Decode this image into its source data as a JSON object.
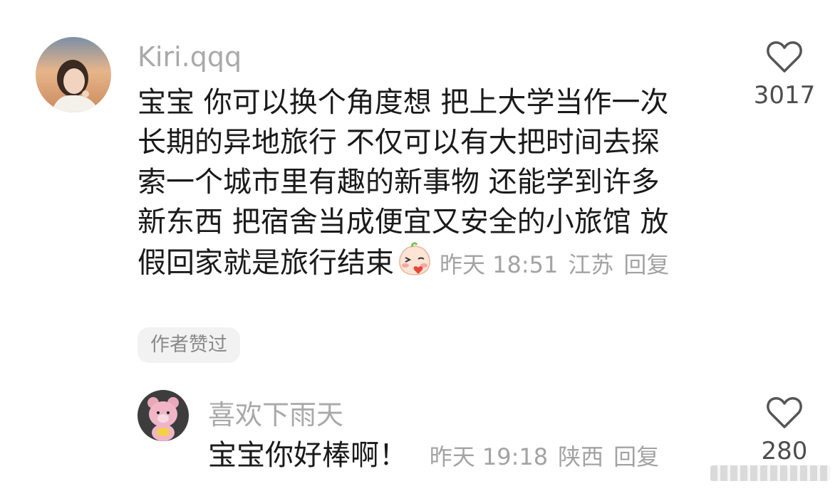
{
  "comment": {
    "username": "Kiri.qqq",
    "lines": [
      "宝宝 你可以换个角度想 把上大学当作一次",
      "长期的异地旅行 不仅可以有大把时间去探",
      "索一个城市里有趣的新事物 还能学到许多",
      "新东西 把宿舍当成便宜又安全的小旅馆 放",
      "假回家就是旅行结束"
    ],
    "emoji": "blushing-peach-sticker",
    "time": "昨天 18:51",
    "location": "江苏",
    "reply_label": "回复",
    "likes": "3017",
    "author_liked_badge": "作者赞过"
  },
  "reply": {
    "username": "喜欢下雨天",
    "text": "宝宝你好棒啊！",
    "time": "昨天 19:18",
    "location": "陕西",
    "reply_label": "回复",
    "likes": "280"
  },
  "colors": {
    "text": "#1a1a1a",
    "meta": "#a3a3a3",
    "badge_bg": "#f2f2f2"
  }
}
